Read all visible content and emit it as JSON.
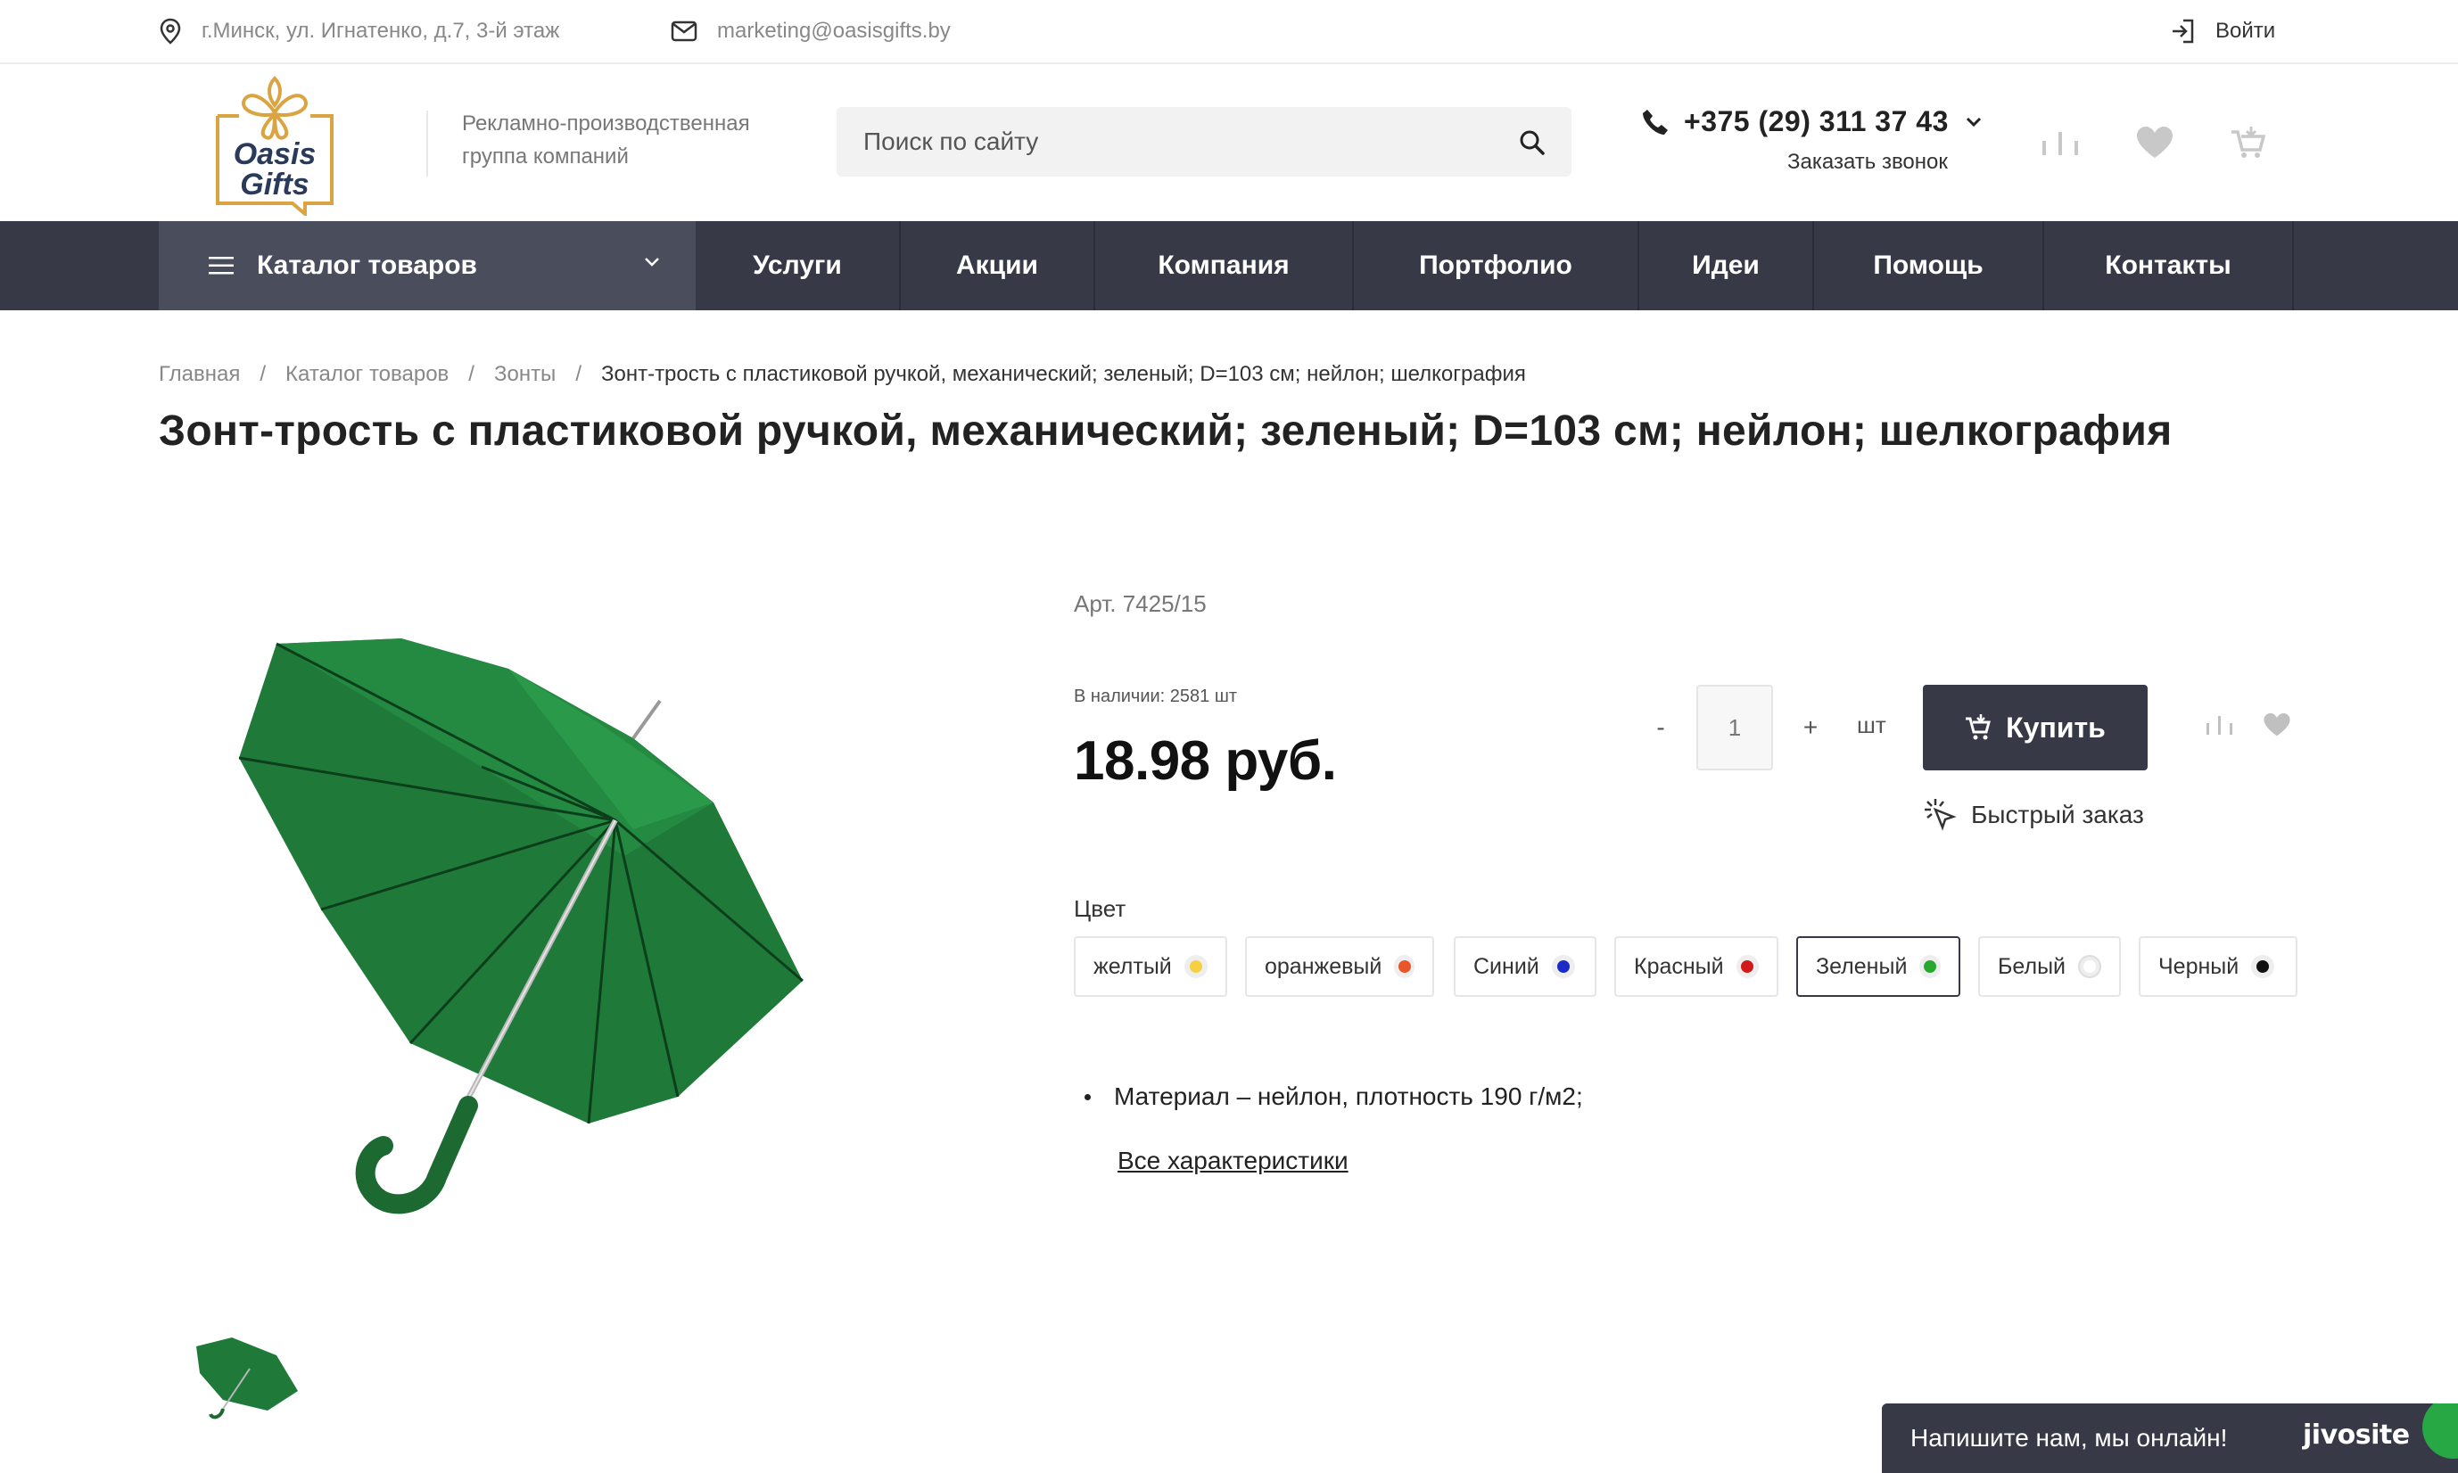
{
  "topbar": {
    "address": "г.Минск, ул. Игнатенко, д.7, 3-й этаж",
    "email": "marketing@oasisgifts.by",
    "login": "Войти"
  },
  "header": {
    "logo_line1": "Oasis",
    "logo_line2": "Gifts",
    "tagline_line1": "Рекламно-производственная",
    "tagline_line2": "группа компаний",
    "search_placeholder": "Поиск по сайту",
    "phone": "+375 (29) 311 37 43",
    "callback": "Заказать звонок"
  },
  "nav": {
    "catalog": "Каталог товаров",
    "items": [
      "Услуги",
      "Акции",
      "Компания",
      "Портфолио",
      "Идеи",
      "Помощь",
      "Контакты"
    ]
  },
  "breadcrumb": [
    "Главная",
    "Каталог товаров",
    "Зонты",
    "Зонт-трость с пластиковой ручкой, механический; зеленый; D=103 см; нейлон; шелкография"
  ],
  "product": {
    "title": "Зонт-трость с пластиковой ручкой, механический; зеленый; D=103 см; нейлон; шелкография",
    "article": "Арт. 7425/15",
    "stock": "В наличии: 2581 шт",
    "price": "18.98 руб.",
    "qty_minus": "-",
    "qty_value": "1",
    "qty_plus": "+",
    "unit": "шт",
    "buy": "Купить",
    "quick_order": "Быстрый заказ",
    "color_label": "Цвет",
    "colors": [
      {
        "name": "желтый",
        "hex": "#f5d142"
      },
      {
        "name": "оранжевый",
        "hex": "#e8562a"
      },
      {
        "name": "Синий",
        "hex": "#1a2bc8"
      },
      {
        "name": "Красный",
        "hex": "#d21a1a"
      },
      {
        "name": "Зеленый",
        "hex": "#27a82e"
      },
      {
        "name": "Белый",
        "hex": "#ffffff"
      },
      {
        "name": "Черный",
        "hex": "#111111"
      }
    ],
    "selected_color": "Зеленый",
    "feature": "Материал – нейлон, плотность 190 г/м2;",
    "all_chars": "Все характеристики"
  },
  "chat": {
    "text": "Напишите нам, мы онлайн!",
    "brand": "jivosite"
  },
  "colors": {
    "nav_bg": "#373a46",
    "catalog_bg": "#4a4e5c",
    "umbrella_green": "#1f7a3a",
    "logo_gold": "#d9a441"
  }
}
